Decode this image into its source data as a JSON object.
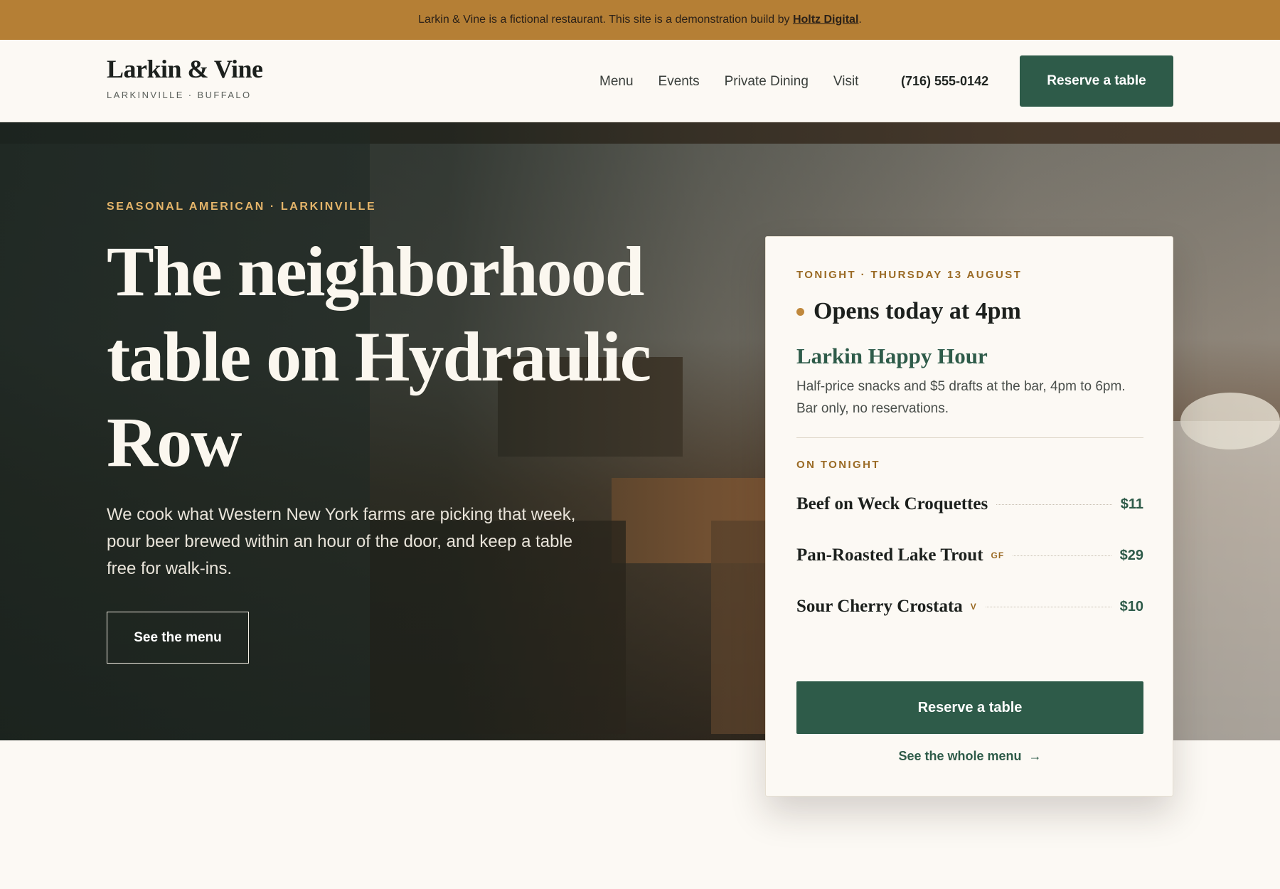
{
  "banner": {
    "text": "Larkin & Vine is a fictional restaurant. This site is a demonstration build by ",
    "link": "Holtz Digital",
    "suffix": "."
  },
  "header": {
    "brand": "Larkin & Vine",
    "tagline": "LARKINVILLE · BUFFALO",
    "nav": [
      "Menu",
      "Events",
      "Private Dining",
      "Visit"
    ],
    "phone": "(716) 555-0142",
    "reserve": "Reserve a table"
  },
  "hero": {
    "eyebrow": "SEASONAL AMERICAN · LARKINVILLE",
    "title": "The neighborhood table on Hydraulic Row",
    "text": "We cook what Western New York farms are picking that week, pour beer brewed within an hour of the door, and keep a table free for walk-ins.",
    "cta": "See the menu"
  },
  "card": {
    "eyebrow": "TONIGHT · THURSDAY 13 AUGUST",
    "status": "Opens today at 4pm",
    "event_title": "Larkin Happy Hour",
    "event_desc": "Half-price snacks and $5 drafts at the bar, 4pm to 6pm. Bar only, no reservations.",
    "section": "ON TONIGHT",
    "dishes": [
      {
        "name": "Beef on Weck Croquettes",
        "tag": "",
        "price": "$11"
      },
      {
        "name": "Pan-Roasted Lake Trout",
        "tag": "GF",
        "price": "$29"
      },
      {
        "name": "Sour Cherry Crostata",
        "tag": "V",
        "price": "$10"
      }
    ],
    "reserve": "Reserve a table",
    "whole_menu": "See the whole menu",
    "arrow": "→"
  },
  "colors": {
    "banner": "#b57f35",
    "accent_green": "#2e5b49",
    "gold": "#9a6a24",
    "page": "#fcf9f4"
  }
}
